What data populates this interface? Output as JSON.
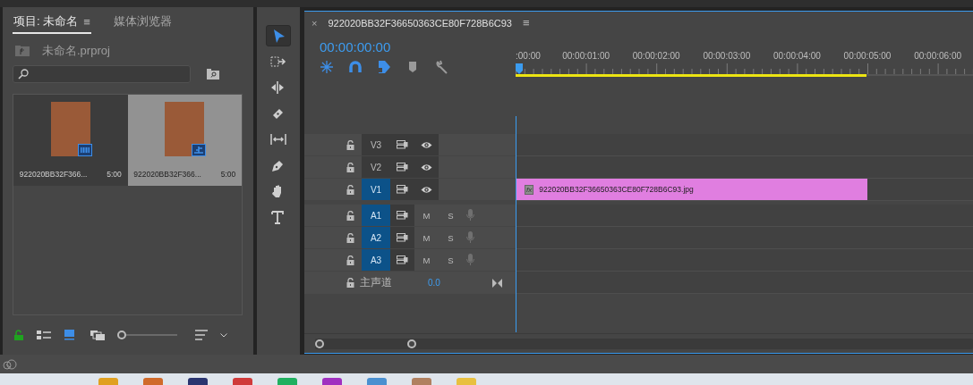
{
  "project_panel": {
    "tabs": [
      {
        "label": "项目: 未命名",
        "selected": true,
        "menu": "≡"
      },
      {
        "label": "媒体浏览器",
        "selected": false
      }
    ],
    "path": "未命名.prproj",
    "items": [
      {
        "name": "922020BB32F366...",
        "duration": "5:00",
        "kind": "clip",
        "selected": false
      },
      {
        "name": "922020BB32F366...",
        "duration": "5:00",
        "kind": "sequence",
        "selected": true
      }
    ],
    "view_modes": [
      {
        "kind": "list",
        "selected": false
      },
      {
        "kind": "icon",
        "selected": true
      },
      {
        "kind": "freeform",
        "selected": false
      }
    ],
    "zoom": {
      "level": 0
    }
  },
  "tools": [
    {
      "kind": "selection",
      "selected": true
    },
    {
      "kind": "track-select",
      "selected": false
    },
    {
      "kind": "ripple",
      "selected": false
    },
    {
      "kind": "razor",
      "selected": false
    },
    {
      "kind": "slip",
      "selected": false
    },
    {
      "kind": "pen",
      "selected": false
    },
    {
      "kind": "hand",
      "selected": false
    },
    {
      "kind": "type",
      "selected": false
    }
  ],
  "timeline": {
    "close": "×",
    "title": "922020BB32F36650363CE80F728B6C93",
    "menu": "≡",
    "timecode": "00:00:00:00",
    "toggles": [
      {
        "kind": "nest",
        "on": true
      },
      {
        "kind": "snap",
        "on": true
      },
      {
        "kind": "linked",
        "on": true
      },
      {
        "kind": "marker",
        "on": false
      },
      {
        "kind": "settings",
        "on": false
      }
    ],
    "ruler_labels": [
      ":00:00",
      "00:00:01:00",
      "00:00:02:00",
      "00:00:03:00",
      "00:00:04:00",
      "00:00:05:00",
      "00:00:06:00"
    ],
    "work_area": {
      "level": 0.767
    },
    "tracks": [
      {
        "name": "V3",
        "kind": "video",
        "targeted": false
      },
      {
        "name": "V2",
        "kind": "video",
        "targeted": false
      },
      {
        "name": "V1",
        "kind": "video",
        "targeted": true,
        "clip": {
          "name": "922020BB32F36650363CE80F728B6C93.jpg",
          "badge": "fx"
        }
      },
      {
        "name": "A1",
        "kind": "audio",
        "targeted": true,
        "mute": "M",
        "solo": "S"
      },
      {
        "name": "A2",
        "kind": "audio",
        "targeted": true,
        "mute": "M",
        "solo": "S"
      },
      {
        "name": "A3",
        "kind": "audio",
        "targeted": true,
        "mute": "M",
        "solo": "S"
      }
    ],
    "master": {
      "name": "主声道",
      "value": "0.0"
    }
  }
}
